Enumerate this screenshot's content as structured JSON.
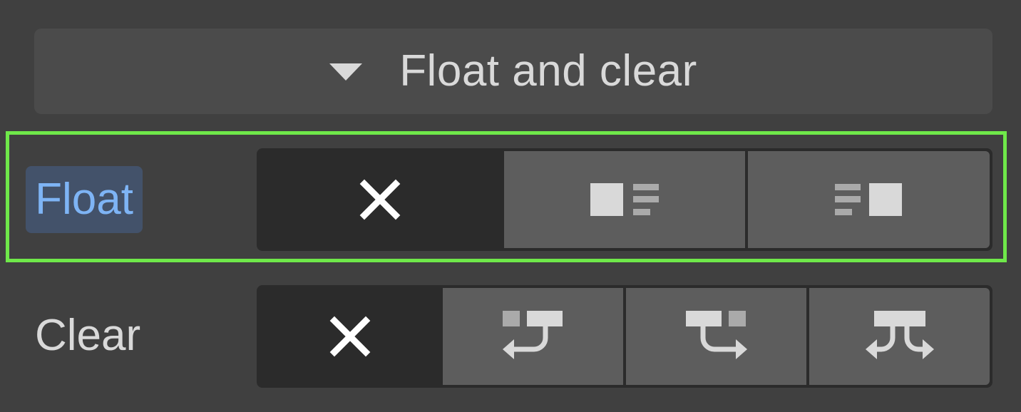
{
  "section": {
    "title": "Float and clear",
    "caret_icon": "caret-down-icon"
  },
  "float": {
    "label": "Float",
    "options": [
      {
        "name": "none",
        "icon": "close-icon",
        "selected": true
      },
      {
        "name": "left",
        "icon": "float-left-icon",
        "selected": false
      },
      {
        "name": "right",
        "icon": "float-right-icon",
        "selected": false
      }
    ]
  },
  "clear": {
    "label": "Clear",
    "options": [
      {
        "name": "none",
        "icon": "close-icon",
        "selected": true
      },
      {
        "name": "left",
        "icon": "clear-left-icon",
        "selected": false
      },
      {
        "name": "right",
        "icon": "clear-right-icon",
        "selected": false
      },
      {
        "name": "both",
        "icon": "clear-both-icon",
        "selected": false
      }
    ]
  },
  "colors": {
    "background": "#404040",
    "header": "#4b4b4b",
    "text": "#d9d9d9",
    "label_highlight_bg": "#43526a",
    "label_highlight_text": "#7eb4f5",
    "focus_outline": "#6fe84a",
    "option_bg": "#5d5d5d",
    "option_selected_bg": "#2b2b2b"
  }
}
